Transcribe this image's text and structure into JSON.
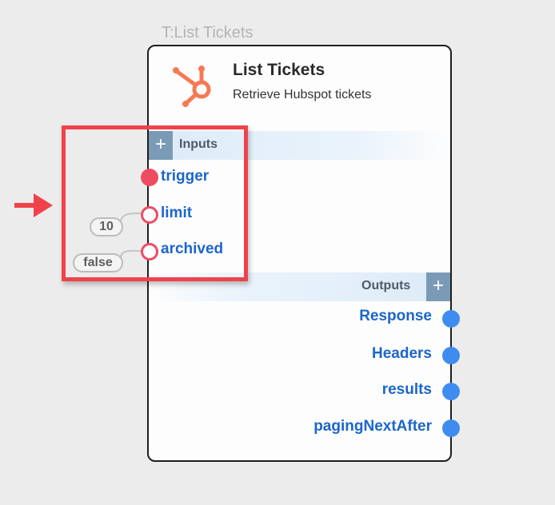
{
  "node": {
    "caption": "T:List Tickets",
    "title": "List Tickets",
    "subtitle": "Retrieve Hubspot tickets",
    "icon": "hubspot-icon",
    "brand_color": "#f57a53"
  },
  "inputs": {
    "label": "Inputs",
    "add_symbol": "+",
    "ports": [
      {
        "name": "trigger",
        "style": "filled",
        "value": null
      },
      {
        "name": "limit",
        "style": "hollow",
        "value": "10"
      },
      {
        "name": "archived",
        "style": "hollow",
        "value": "false"
      }
    ]
  },
  "outputs": {
    "label": "Outputs",
    "add_symbol": "+",
    "ports": [
      {
        "name": "Response"
      },
      {
        "name": "Headers"
      },
      {
        "name": "results"
      },
      {
        "name": "pagingNextAfter"
      }
    ]
  },
  "annotation": {
    "color": "#f0424b",
    "arrow_icon": "arrow-right-icon"
  }
}
